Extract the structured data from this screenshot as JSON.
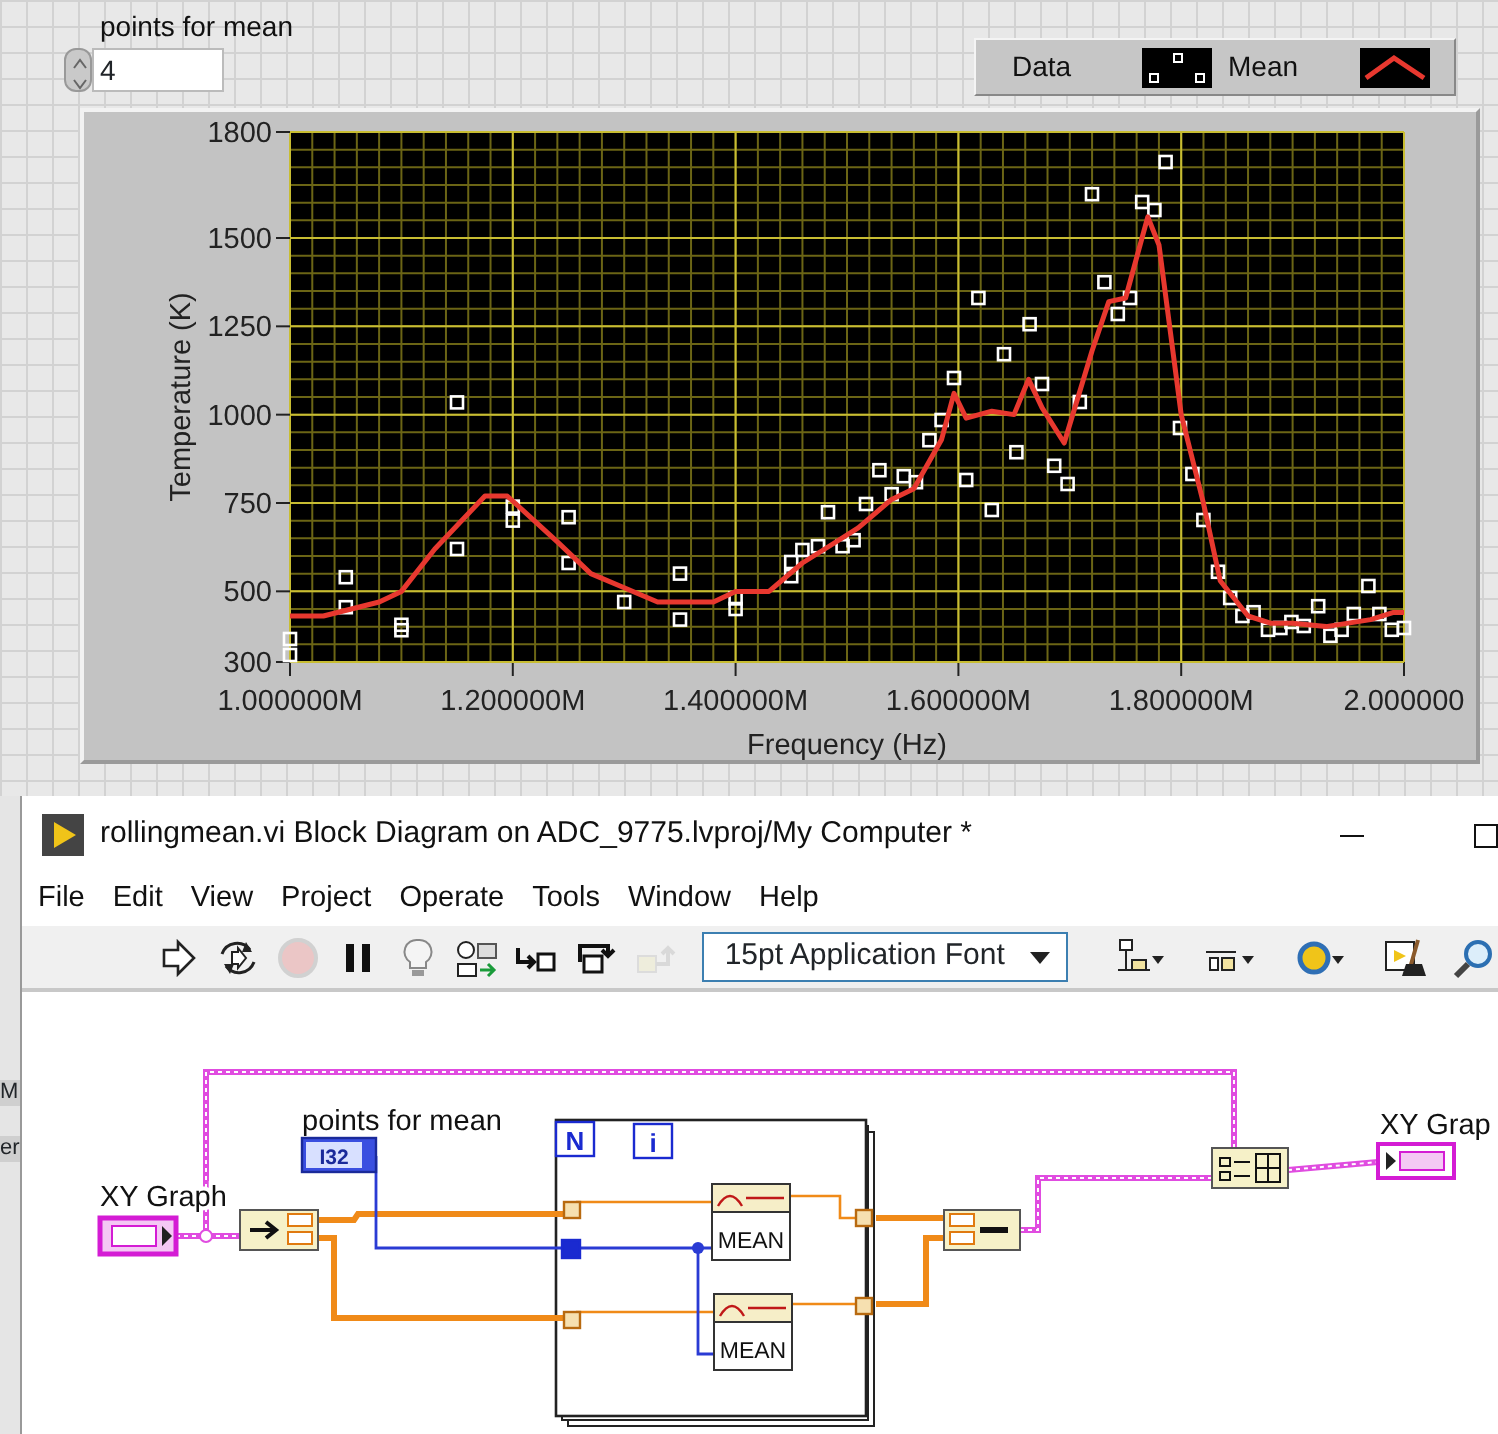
{
  "front_panel": {
    "numeric": {
      "label": "points for mean",
      "value": "4"
    },
    "graph": {
      "chart_data": {
        "type": "scatter",
        "xlabel": "Frequency (Hz)",
        "ylabel": "Temperature (K)",
        "grid": true,
        "xlim": [
          1.0,
          2.0
        ],
        "ylim": [
          300,
          1800
        ],
        "xticks": [
          {
            "value": 1.0,
            "label": "1.000000M"
          },
          {
            "value": 1.2,
            "label": "1.200000M"
          },
          {
            "value": 1.4,
            "label": "1.400000M"
          },
          {
            "value": 1.6,
            "label": "1.600000M"
          },
          {
            "value": 1.8,
            "label": "1.800000M"
          },
          {
            "value": 2.0,
            "label": "2.000000"
          }
        ],
        "yticks": [
          300,
          500,
          750,
          1000,
          1250,
          1500,
          1800
        ],
        "series": [
          {
            "name": "Data",
            "color": "#ffffff",
            "x": [
              1.0,
              1.0,
              1.05,
              1.05,
              1.1,
              1.1,
              1.15,
              1.15,
              1.2,
              1.2,
              1.25,
              1.25,
              1.3,
              1.35,
              1.35,
              1.4,
              1.4,
              1.45,
              1.45,
              1.46,
              1.474,
              1.483,
              1.496,
              1.506,
              1.517,
              1.529,
              1.54,
              1.551,
              1.562,
              1.574,
              1.585,
              1.596,
              1.607,
              1.618,
              1.63,
              1.641,
              1.652,
              1.664,
              1.675,
              1.686,
              1.698,
              1.709,
              1.72,
              1.731,
              1.743,
              1.754,
              1.765,
              1.776,
              1.786,
              1.799,
              1.81,
              1.82,
              1.833,
              1.844,
              1.855,
              1.865,
              1.878,
              1.889,
              1.899,
              1.91,
              1.923,
              1.934,
              1.944,
              1.955,
              1.968,
              1.978,
              1.989,
              2.0
            ],
            "values": [
              365,
              320,
              540,
              455,
              405,
              390,
              1035,
              620,
              740,
              700,
              710,
              580,
              470,
              550,
              420,
              480,
              450,
              583,
              543,
              617,
              628,
              724,
              628,
              645,
              747,
              843,
              775,
              826,
              809,
              928,
              985,
              1104,
              815,
              1330,
              730,
              1171,
              894,
              1256,
              1087,
              855,
              804,
              1036,
              1624,
              1375,
              1285,
              1330,
              1602,
              1579,
              1715,
              962,
              832,
              702,
              555,
              481,
              430,
              441,
              391,
              396,
              413,
              402,
              458,
              374,
              391,
              436,
              515,
              436,
              391,
              396
            ]
          },
          {
            "name": "Mean",
            "type": "line",
            "color": "#e8382f",
            "x": [
              1.0,
              1.03,
              1.08,
              1.1,
              1.13,
              1.175,
              1.195,
              1.24,
              1.27,
              1.3,
              1.33,
              1.38,
              1.4,
              1.43,
              1.46,
              1.48,
              1.51,
              1.54,
              1.56,
              1.585,
              1.596,
              1.607,
              1.63,
              1.65,
              1.663,
              1.675,
              1.695,
              1.72,
              1.735,
              1.75,
              1.77,
              1.78,
              1.8,
              1.82,
              1.835,
              1.86,
              1.88,
              1.9,
              1.93,
              1.97,
              1.99,
              2.0
            ],
            "values": [
              430,
              430,
              470,
              500,
              620,
              770,
              770,
              640,
              550,
              510,
              470,
              470,
              500,
              500,
              580,
              620,
              680,
              760,
              790,
              930,
              1060,
              990,
              1010,
              1000,
              1100,
              1020,
              920,
              1180,
              1320,
              1330,
              1560,
              1480,
              1000,
              750,
              530,
              430,
              410,
              410,
              400,
              420,
              440,
              440
            ]
          }
        ]
      }
    }
  },
  "background_window": {
    "fragments": [
      "M",
      "er"
    ]
  },
  "block_diagram": {
    "window_title": "rollingmean.vi Block Diagram on ADC_9775.lvproj/My Computer *",
    "menu": [
      "File",
      "Edit",
      "View",
      "Project",
      "Operate",
      "Tools",
      "Window",
      "Help"
    ],
    "toolbar": [
      {
        "kind": "run",
        "disabled": false
      },
      {
        "kind": "run-continuously",
        "disabled": false
      },
      {
        "kind": "abort",
        "disabled": true
      },
      {
        "kind": "pause",
        "disabled": false
      },
      {
        "kind": "highlight",
        "disabled": false
      },
      {
        "kind": "retain",
        "disabled": false
      },
      {
        "kind": "step-into",
        "disabled": false
      },
      {
        "kind": "step-over",
        "disabled": false
      },
      {
        "kind": "step-out",
        "disabled": true
      },
      {
        "kind": "font",
        "value": "15pt Application Font"
      },
      {
        "kind": "align",
        "disabled": false
      },
      {
        "kind": "distribute",
        "disabled": false
      },
      {
        "kind": "reorder",
        "disabled": false
      },
      {
        "kind": "cleanup",
        "disabled": false
      },
      {
        "kind": "search",
        "disabled": false
      }
    ],
    "diagram": {
      "input_label": "XY Graph",
      "control_label": "points for mean",
      "control_type": "I32",
      "loop_count": "N",
      "loop_index": "i",
      "mean_nodes": [
        "MEAN",
        "MEAN"
      ],
      "output_label": "XY Grap"
    }
  }
}
